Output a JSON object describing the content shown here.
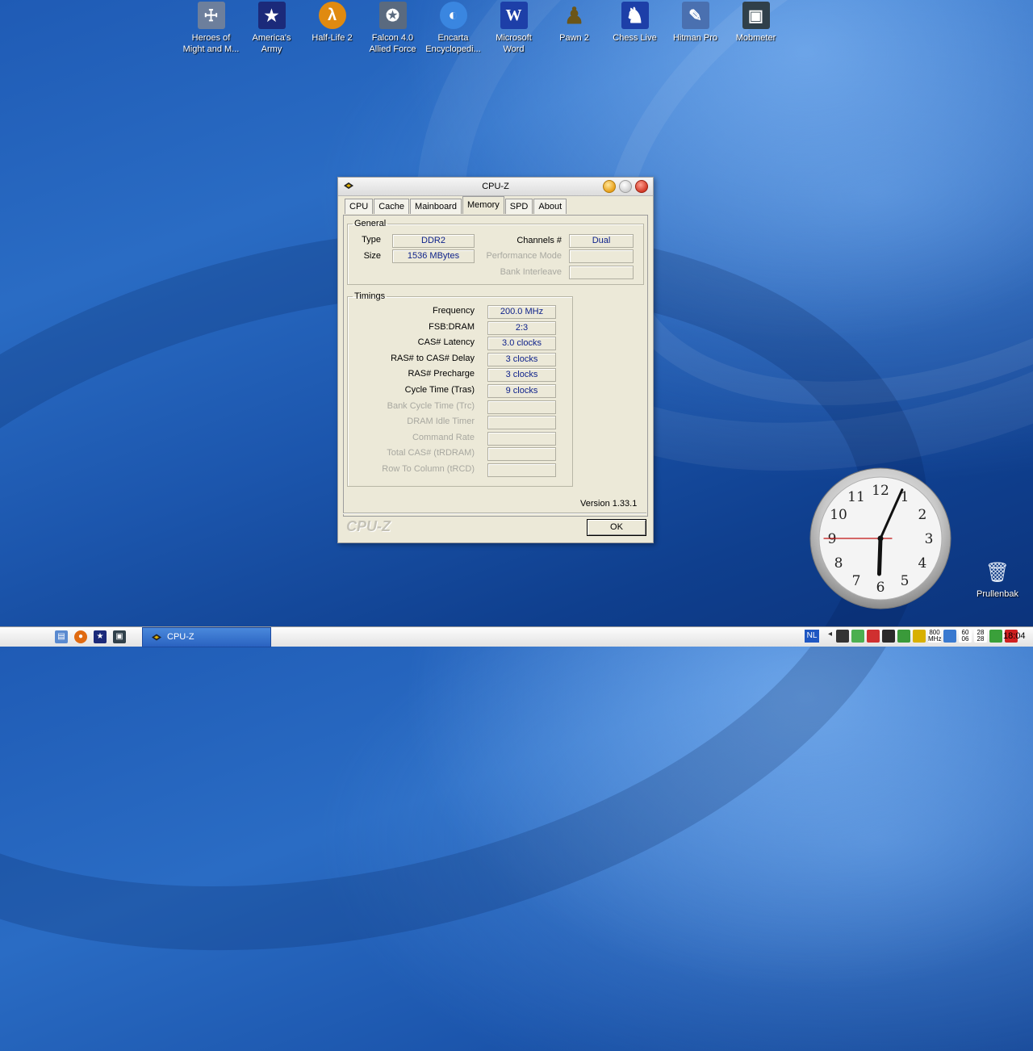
{
  "desktop": {
    "icons": [
      {
        "label": "Heroes of\nMight and M...",
        "icon": "heroes-icon",
        "color": "#6d7f9c",
        "glyph": "☩"
      },
      {
        "label": "America's\nArmy",
        "icon": "americas-army-icon",
        "color": "#b3172e",
        "glyph": "★"
      },
      {
        "label": "Half-Life 2",
        "icon": "half-life-icon",
        "color": "#e08a10",
        "glyph": "λ"
      },
      {
        "label": "Falcon 4.0\nAllied Force",
        "icon": "falcon-icon",
        "color": "#5a6a7f",
        "glyph": "✪"
      },
      {
        "label": "Encarta\nEncyclopedi...",
        "icon": "encarta-icon",
        "color": "#3a86e0",
        "glyph": "◐"
      },
      {
        "label": "Microsoft\nWord",
        "icon": "word-icon",
        "color": "#1d3fa8",
        "glyph": "W"
      },
      {
        "label": "Pawn 2",
        "icon": "pawn-icon",
        "color": "#5a4a1a",
        "glyph": "♟"
      },
      {
        "label": "Chess Live",
        "icon": "chess-icon",
        "color": "#1d3fa8",
        "glyph": "♞"
      },
      {
        "label": "Hitman Pro",
        "icon": "hitman-icon",
        "color": "#4a70b0",
        "glyph": "✎"
      },
      {
        "label": "Mobmeter",
        "icon": "mobmeter-icon",
        "color": "#30404a",
        "glyph": "▣"
      }
    ],
    "recycle_bin": {
      "label": "Prullenbak",
      "icon": "recycle-bin-icon"
    }
  },
  "clock": {
    "numerals": [
      "12",
      "1",
      "2",
      "3",
      "4",
      "5",
      "6",
      "7",
      "8",
      "9",
      "10",
      "11"
    ],
    "hour": 6,
    "minute": 4,
    "second": 45
  },
  "window": {
    "title": "CPU-Z",
    "tabs": [
      "CPU",
      "Cache",
      "Mainboard",
      "Memory",
      "SPD",
      "About"
    ],
    "active_tab": "Memory",
    "general": {
      "legend": "General",
      "type_label": "Type",
      "type_value": "DDR2",
      "size_label": "Size",
      "size_value": "1536 MBytes",
      "channels_label": "Channels #",
      "channels_value": "Dual",
      "perf_mode_label": "Performance Mode",
      "perf_mode_value": "",
      "bank_interleave_label": "Bank Interleave",
      "bank_interleave_value": ""
    },
    "timings": {
      "legend": "Timings",
      "rows": [
        {
          "label": "Frequency",
          "value": "200.0 MHz",
          "enabled": true
        },
        {
          "label": "FSB:DRAM",
          "value": "2:3",
          "enabled": true
        },
        {
          "label": "CAS# Latency",
          "value": "3.0 clocks",
          "enabled": true
        },
        {
          "label": "RAS# to CAS# Delay",
          "value": "3 clocks",
          "enabled": true
        },
        {
          "label": "RAS# Precharge",
          "value": "3 clocks",
          "enabled": true
        },
        {
          "label": "Cycle Time (Tras)",
          "value": "9 clocks",
          "enabled": true
        },
        {
          "label": "Bank Cycle Time (Trc)",
          "value": "",
          "enabled": false
        },
        {
          "label": "DRAM Idle Timer",
          "value": "",
          "enabled": false
        },
        {
          "label": "Command Rate",
          "value": "",
          "enabled": false
        },
        {
          "label": "Total CAS# (tRDRAM)",
          "value": "",
          "enabled": false
        },
        {
          "label": "Row To Column (tRCD)",
          "value": "",
          "enabled": false
        }
      ]
    },
    "version": "Version 1.33.1",
    "brand": "CPU-Z",
    "ok_label": "OK"
  },
  "taskbar": {
    "start_icon": "apple-icon",
    "quick_launch": [
      {
        "icon": "show-desktop-icon",
        "color": "#5a8ad0",
        "glyph": "▤"
      },
      {
        "icon": "firefox-icon",
        "color": "#e06a10",
        "glyph": "●"
      },
      {
        "icon": "americas-army-icon",
        "color": "#b3172e",
        "glyph": "★"
      },
      {
        "icon": "mobmeter-icon",
        "color": "#30404a",
        "glyph": "▣"
      }
    ],
    "task_label": "CPU-Z",
    "language": "NL",
    "tray_icons": [
      {
        "icon": "steam-icon",
        "color": "#333333",
        "text": ""
      },
      {
        "icon": "messenger-icon",
        "color": "#4caf50",
        "text": ""
      },
      {
        "icon": "no-entry-icon",
        "color": "#d03030",
        "text": ""
      },
      {
        "icon": "cpu-graph-icon",
        "color": "#2a2a2a",
        "text": ""
      },
      {
        "icon": "network-bar-icon",
        "color": "#3a9a3a",
        "text": ""
      },
      {
        "icon": "flag-icon",
        "color": "#d8b000",
        "text": ""
      },
      {
        "icon": "speed-icon",
        "color": "#ffffff",
        "text": "800\nMHz"
      },
      {
        "icon": "monitor-icon",
        "color": "#3a7ad0",
        "text": ""
      },
      {
        "icon": "temperature-icon",
        "color": "#ffffff",
        "text": "60\n06"
      },
      {
        "icon": "temperature-icon-2",
        "color": "#ffffff",
        "text": "28\n28"
      },
      {
        "icon": "wifi-icon",
        "color": "#3aa03a",
        "text": ""
      },
      {
        "icon": "shield-icon",
        "color": "#d02020",
        "text": ""
      }
    ],
    "time": "18:04"
  }
}
